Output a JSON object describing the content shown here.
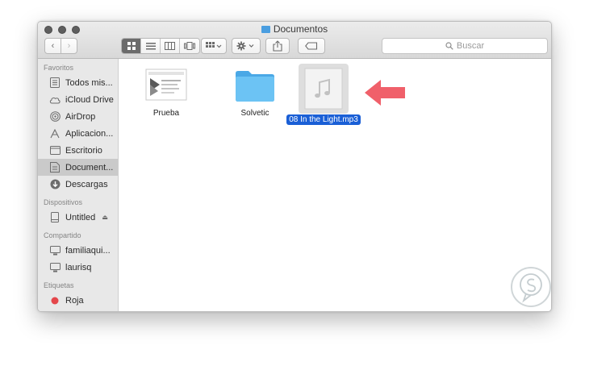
{
  "window": {
    "title": "Documentos"
  },
  "toolbar": {
    "back": "‹",
    "forward": "›",
    "search_placeholder": "Buscar"
  },
  "sidebar": {
    "sections": [
      {
        "title": "Favoritos",
        "items": [
          {
            "label": "Todos mis...",
            "icon": "all-files-icon"
          },
          {
            "label": "iCloud Drive",
            "icon": "cloud-icon"
          },
          {
            "label": "AirDrop",
            "icon": "airdrop-icon"
          },
          {
            "label": "Aplicacion...",
            "icon": "applications-icon"
          },
          {
            "label": "Escritorio",
            "icon": "desktop-icon"
          },
          {
            "label": "Document...",
            "icon": "documents-icon",
            "selected": true
          },
          {
            "label": "Descargas",
            "icon": "downloads-icon"
          }
        ]
      },
      {
        "title": "Dispositivos",
        "items": [
          {
            "label": "Untitled",
            "icon": "disk-icon",
            "eject": "⏏"
          }
        ]
      },
      {
        "title": "Compartido",
        "items": [
          {
            "label": "familiaqui...",
            "icon": "computer-icon"
          },
          {
            "label": "laurisq",
            "icon": "computer-icon"
          }
        ]
      },
      {
        "title": "Etiquetas",
        "items": [
          {
            "label": "Roja",
            "icon": "red-tag-icon",
            "color": "#e4474b"
          }
        ]
      }
    ]
  },
  "files": [
    {
      "name": "Prueba",
      "kind": "document"
    },
    {
      "name": "Solvetic",
      "kind": "folder"
    },
    {
      "name": "08 In the Light.mp3",
      "kind": "audio",
      "selected": true
    }
  ],
  "colors": {
    "selection": "#1a5fd6",
    "folder": "#5bb8f0",
    "arrow": "#f0606a"
  }
}
